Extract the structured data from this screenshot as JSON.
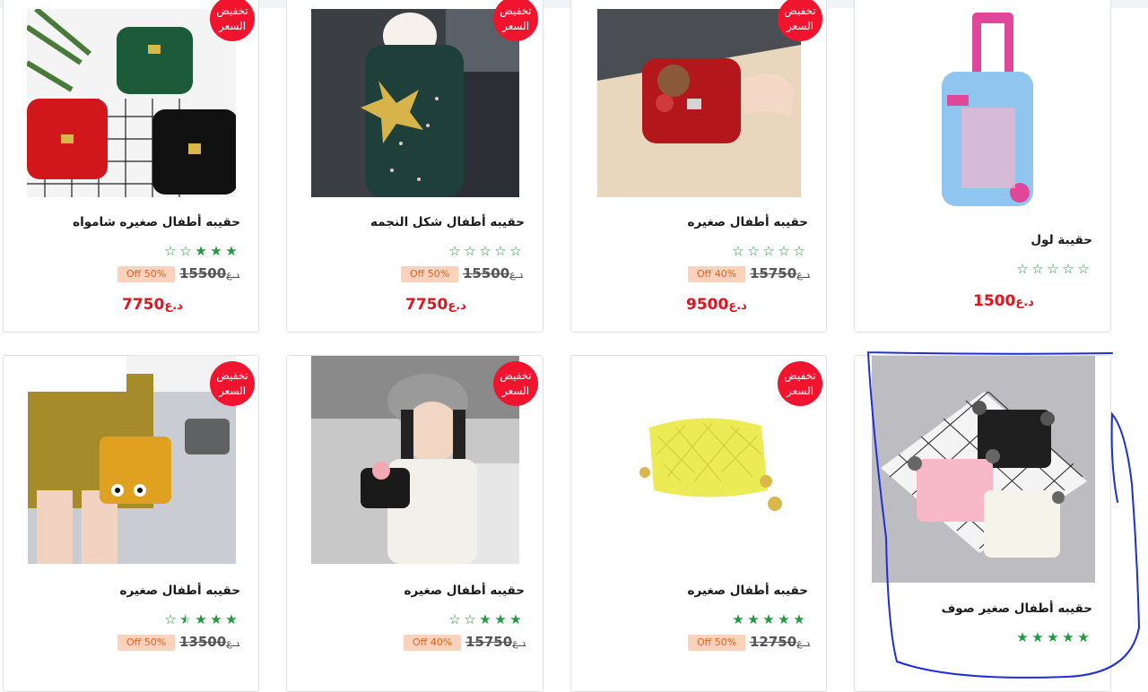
{
  "products": [
    {
      "title": "حقيبه أطفال صغيره شامواه",
      "stars": [
        1,
        1,
        1,
        0,
        0
      ],
      "old_price": "15500",
      "currency_label": "د.ع",
      "discount": "Off 50%",
      "price": "7750",
      "currency": "د.ع",
      "badge": "تخفيض\nالسعر"
    },
    {
      "title": "حقيبه أطفال شكل النجمه",
      "stars": [
        0,
        0,
        0,
        0,
        0
      ],
      "old_price": "15500",
      "currency_label": "د.ع",
      "discount": "Off 50%",
      "price": "7750",
      "currency": "د.ع",
      "badge": "تخفيض\nالسعر"
    },
    {
      "title": "حقيبه أطفال صغيره",
      "stars": [
        0,
        0,
        0,
        0,
        0
      ],
      "old_price": "15750",
      "currency_label": "د.ع",
      "discount": "Off 40%",
      "price": "9500",
      "currency": "د.ع",
      "badge": "تخفيض\nالسعر"
    },
    {
      "title": "حقيبة لول",
      "stars": [
        0,
        0,
        0,
        0,
        0
      ],
      "price": "1500",
      "currency": "د.ع"
    },
    {
      "title": "حقيبه أطفال صغيره",
      "stars": [
        1,
        1,
        1,
        0.5,
        0
      ],
      "old_price": "13500",
      "currency_label": "د.ع",
      "discount": "Off 50%",
      "badge": "تخفيض\nالسعر"
    },
    {
      "title": "حقيبه أطفال صغيره",
      "stars": [
        1,
        1,
        1,
        0,
        0
      ],
      "old_price": "15750",
      "currency_label": "د.ع",
      "discount": "Off 40%",
      "badge": "تخفيض\nالسعر"
    },
    {
      "title": "حقيبه أطفال صغيره",
      "stars": [
        1,
        1,
        1,
        1,
        1
      ],
      "old_price": "12750",
      "currency_label": "د.ع",
      "discount": "Off 50%",
      "badge": "تخفيض\nالسعر"
    },
    {
      "title": "حقيبه أطفال صغير صوف",
      "stars": [
        1,
        1,
        1,
        1,
        1
      ]
    }
  ],
  "colors": {
    "badge": "#f0142f",
    "star": "#1f9a3f",
    "price": "#e0141f",
    "discount_bg": "#fdd2bd",
    "discount_text": "#e0641e",
    "annotation": "#1f2fd1"
  }
}
